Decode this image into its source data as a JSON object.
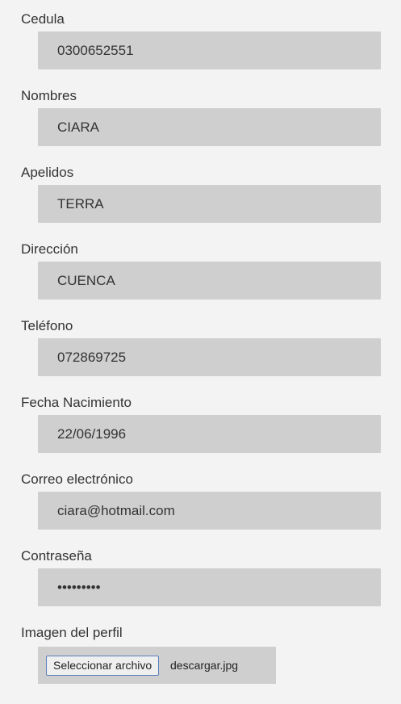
{
  "form": {
    "fields": [
      {
        "label": "Cedula",
        "value": "0300652551"
      },
      {
        "label": "Nombres",
        "value": "CIARA"
      },
      {
        "label": "Apelidos",
        "value": "TERRA"
      },
      {
        "label": "Dirección",
        "value": "CUENCA"
      },
      {
        "label": "Teléfono",
        "value": "072869725"
      },
      {
        "label": "Fecha Nacimiento",
        "value": "22/06/1996"
      },
      {
        "label": "Correo electrónico",
        "value": "ciara@hotmail.com"
      },
      {
        "label": "Contraseña",
        "value": "•••••••••"
      }
    ],
    "image": {
      "label": "Imagen del perfil",
      "button_label": "Seleccionar archivo",
      "file_name": "descargar.jpg"
    }
  }
}
